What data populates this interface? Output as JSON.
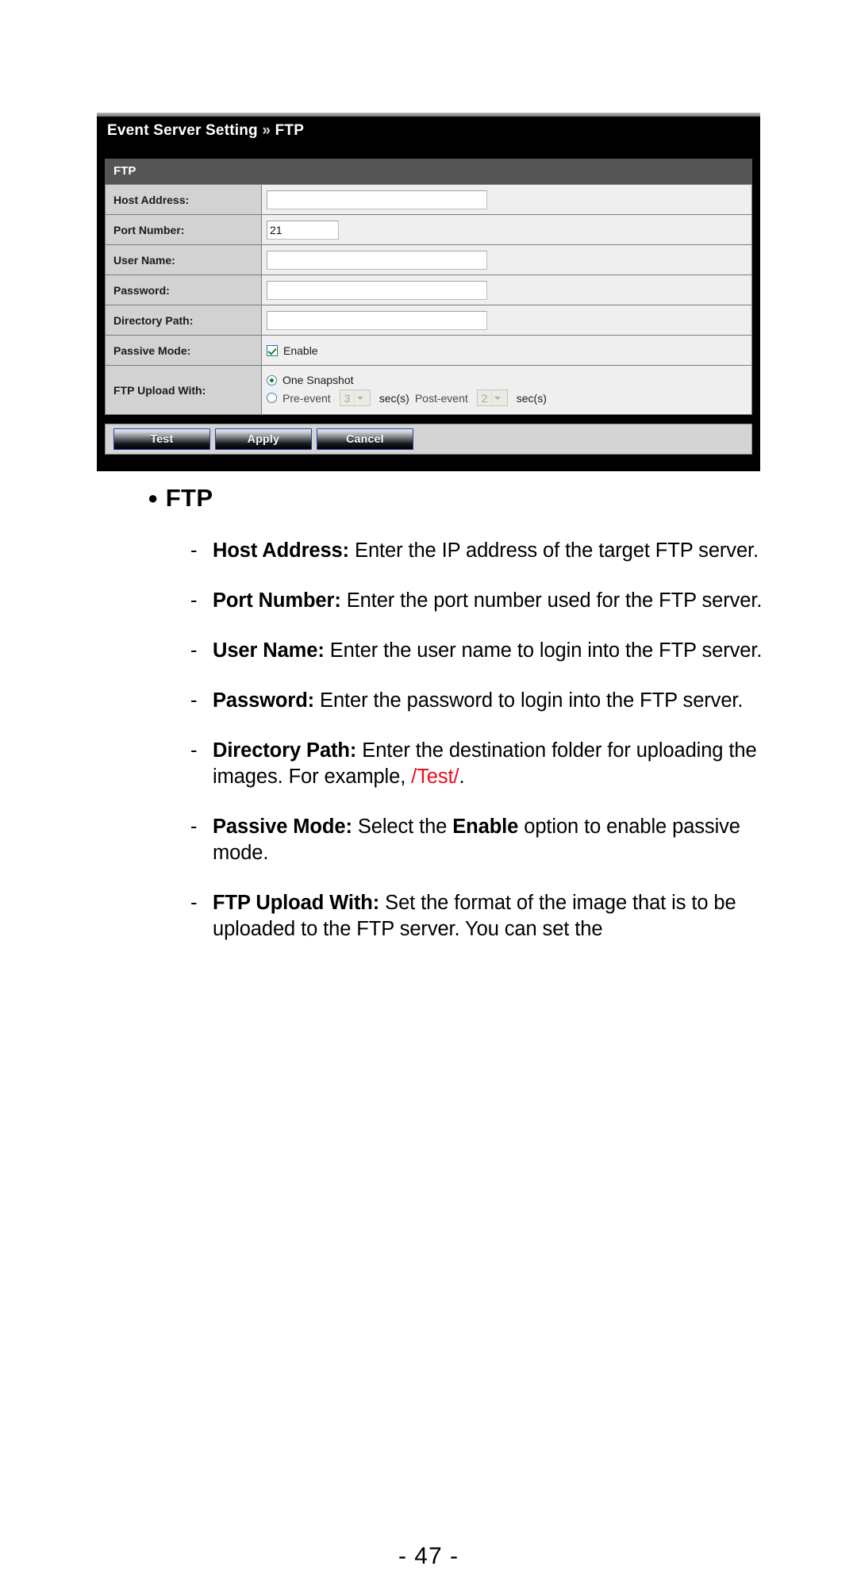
{
  "screenshot": {
    "title_main": "Event Server Setting",
    "title_sep": "»",
    "title_sub": "FTP",
    "section_header": "FTP",
    "rows": [
      {
        "label": "Host Address:",
        "value": "",
        "placeholder": ""
      },
      {
        "label": "Port Number:",
        "value": "21",
        "placeholder": ""
      },
      {
        "label": "User Name:",
        "value": "",
        "placeholder": ""
      },
      {
        "label": "Password:",
        "value": "",
        "placeholder": ""
      },
      {
        "label": "Directory Path:",
        "value": "",
        "placeholder": ""
      }
    ],
    "passive_mode": {
      "label": "Passive Mode:",
      "checkbox_label": "Enable",
      "checked": "true"
    },
    "upload_with": {
      "label": "FTP Upload With:",
      "option_one": "One Snapshot",
      "option_two_pre": "Pre-event",
      "pre_value": "3",
      "unit_pre": "sec(s)",
      "option_two_post": "Post-event",
      "post_value": "2",
      "unit_post": "sec(s)",
      "selected": "One Snapshot"
    },
    "buttons": {
      "test": "Test",
      "apply": "Apply",
      "cancel": "Cancel"
    }
  },
  "document": {
    "heading_bullet": "●",
    "heading": "FTP",
    "items": [
      {
        "dash": "-",
        "term": "Host Address:",
        "text": " Enter the IP address of the target FTP server."
      },
      {
        "dash": "-",
        "term": "Port Number:",
        "text": " Enter the port number used for the FTP server."
      },
      {
        "dash": "-",
        "term": "User Name:",
        "text": " Enter the user name to login into the FTP server."
      },
      {
        "dash": "-",
        "term": "Password:",
        "text": " Enter the password to login into the FTP server."
      },
      {
        "dash": "-",
        "term": "Directory Path:",
        "text_before": " Enter the destination folder for uploading the images. For example, ",
        "highlight": "/Test/",
        "text_after": "."
      },
      {
        "dash": "-",
        "term": "Passive Mode:",
        "text_before": " Select the ",
        "emphasis": "Enable",
        "text_after": " option to enable passive mode."
      },
      {
        "dash": "-",
        "term": "FTP Upload With:",
        "text": " Set the format of the image that is to be uploaded to the FTP server. You can set the"
      }
    ],
    "page_number": "- 47 -"
  },
  "colors": {
    "title_bar": "#000000",
    "section_bar": "#555555",
    "label_cell": "#d2d2d2",
    "value_cell": "#efefef",
    "highlight_red": "#e8101b",
    "check_green": "#128d16"
  }
}
